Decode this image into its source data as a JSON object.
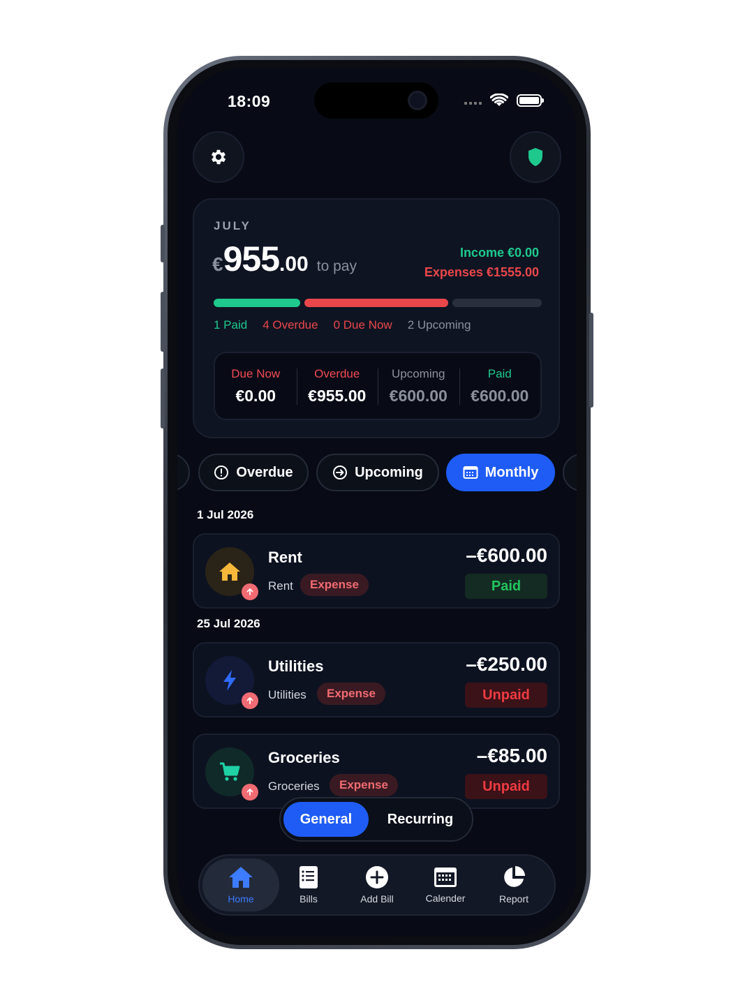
{
  "status_bar": {
    "time": "18:09"
  },
  "summary": {
    "month": "JULY",
    "currency": "€",
    "amount_int": "955",
    "amount_dec": ".00",
    "to_pay": "to pay",
    "income": "Income €0.00",
    "expenses": "Expenses €1555.00",
    "progress": {
      "paid_fraction": 0.27,
      "overdue_fraction": 0.45,
      "upcoming_fraction": 0.28
    },
    "legend": {
      "paid": "1 Paid",
      "overdue": "4 Overdue",
      "due_now": "0 Due Now",
      "upcoming": "2 Upcoming"
    },
    "stats": [
      {
        "label": "Due Now",
        "value": "€0.00",
        "label_color": "#f04a55",
        "value_color": "#ffffff"
      },
      {
        "label": "Overdue",
        "value": "€955.00",
        "label_color": "#f04a55",
        "value_color": "#ffffff"
      },
      {
        "label": "Upcoming",
        "value": "€600.00",
        "label_color": "#8b909c",
        "value_color": "#8b909c"
      },
      {
        "label": "Paid",
        "value": "€600.00",
        "label_color": "#1fc98e",
        "value_color": "#8b909c"
      }
    ]
  },
  "filters": {
    "overdue": "Overdue",
    "upcoming": "Upcoming",
    "monthly": "Monthly"
  },
  "groups": [
    {
      "date": "1 Jul 2026"
    },
    {
      "date": "25 Jul 2026"
    }
  ],
  "bills": [
    {
      "name": "Rent",
      "category": "Rent",
      "type": "Expense",
      "amount": "–€600.00",
      "status": "Paid",
      "icon": "house-icon"
    },
    {
      "name": "Utilities",
      "category": "Utilities",
      "type": "Expense",
      "amount": "–€250.00",
      "status": "Unpaid",
      "icon": "lightning-icon"
    },
    {
      "name": "Groceries",
      "category": "Groceries",
      "type": "Expense",
      "amount": "–€85.00",
      "status": "Unpaid",
      "icon": "cart-icon"
    }
  ],
  "segment": {
    "general": "General",
    "recurring": "Recurring"
  },
  "nav": {
    "home": "Home",
    "bills": "Bills",
    "add_bill": "Add Bill",
    "calendar": "Calender",
    "report": "Report"
  },
  "colors": {
    "accent": "#1f5cf5",
    "income": "#1fc98e",
    "expense": "#e9474a",
    "background": "#080b15"
  }
}
